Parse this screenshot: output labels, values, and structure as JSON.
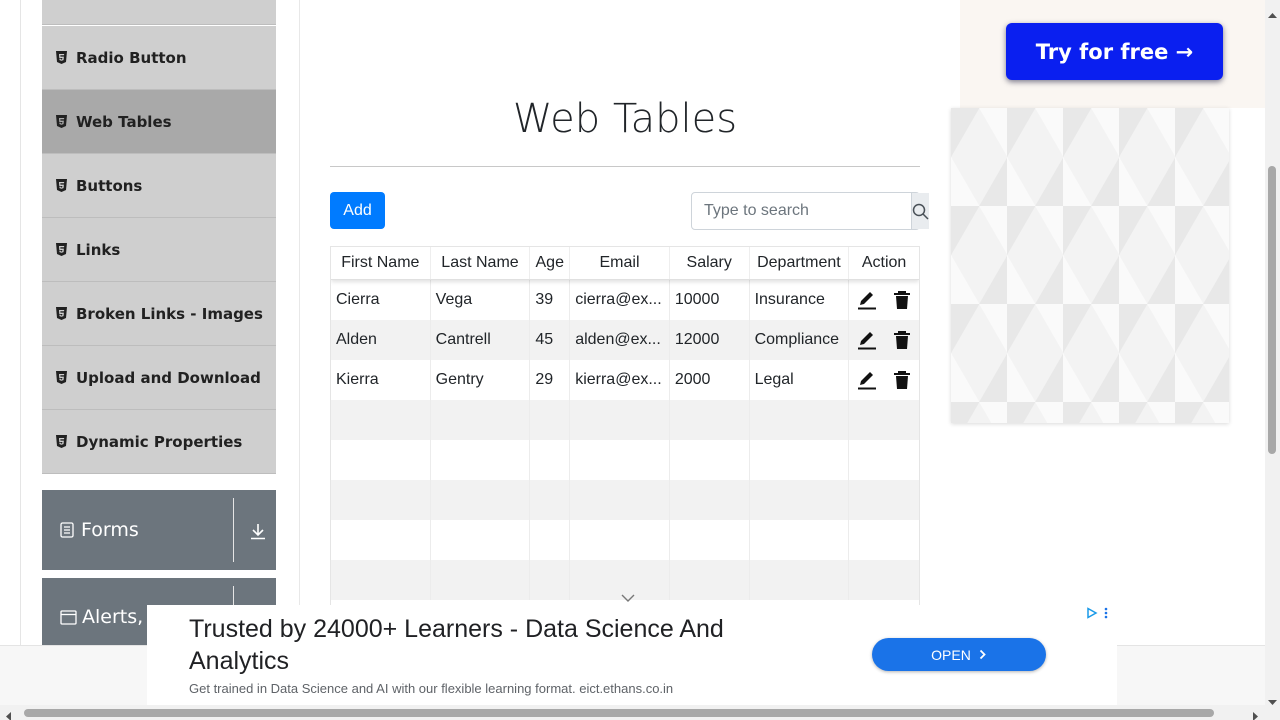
{
  "sidebar": {
    "items": [
      {
        "label": "Radio Button",
        "active": false
      },
      {
        "label": "Web Tables",
        "active": true
      },
      {
        "label": "Buttons",
        "active": false
      },
      {
        "label": "Links",
        "active": false
      },
      {
        "label": "Broken Links - Images",
        "active": false
      },
      {
        "label": "Upload and Download",
        "active": false
      },
      {
        "label": "Dynamic Properties",
        "active": false
      }
    ],
    "groups": [
      {
        "label": "Forms",
        "icon": "form-icon"
      },
      {
        "label": "Alerts, Frame & Windows",
        "icon": "window-icon"
      }
    ],
    "colors": {
      "item_bg": "#cfcfcf",
      "active_bg": "#a9a9a9",
      "group_bg": "#6c757d"
    }
  },
  "main": {
    "title": "Web Tables",
    "add_label": "Add",
    "search": {
      "placeholder": "Type to search",
      "icon": "search-icon"
    },
    "table": {
      "columns": [
        "First Name",
        "Last Name",
        "Age",
        "Email",
        "Salary",
        "Department",
        "Action"
      ],
      "rows": [
        {
          "first": "Cierra",
          "last": "Vega",
          "age": "39",
          "email": "cierra@ex...",
          "salary": "10000",
          "department": "Insurance"
        },
        {
          "first": "Alden",
          "last": "Cantrell",
          "age": "45",
          "email": "alden@ex...",
          "salary": "12000",
          "department": "Compliance"
        },
        {
          "first": "Kierra",
          "last": "Gentry",
          "age": "29",
          "email": "kierra@ex...",
          "salary": "2000",
          "department": "Legal"
        }
      ],
      "empty_rows": 5,
      "action_icons": [
        "edit-icon",
        "delete-icon"
      ]
    },
    "colors": {
      "primary": "#007bff"
    }
  },
  "side_ad": {
    "cta": "Try for free →",
    "color": "#0a1ff0"
  },
  "bottom_ad": {
    "headline": "Trusted by 24000+ Learners - Data Science And Analytics",
    "subtext": "Get trained in Data Science and AI with our flexible learning format. eict.ethans.co.in",
    "cta": "OPEN",
    "cta_color": "#1a73e8"
  }
}
